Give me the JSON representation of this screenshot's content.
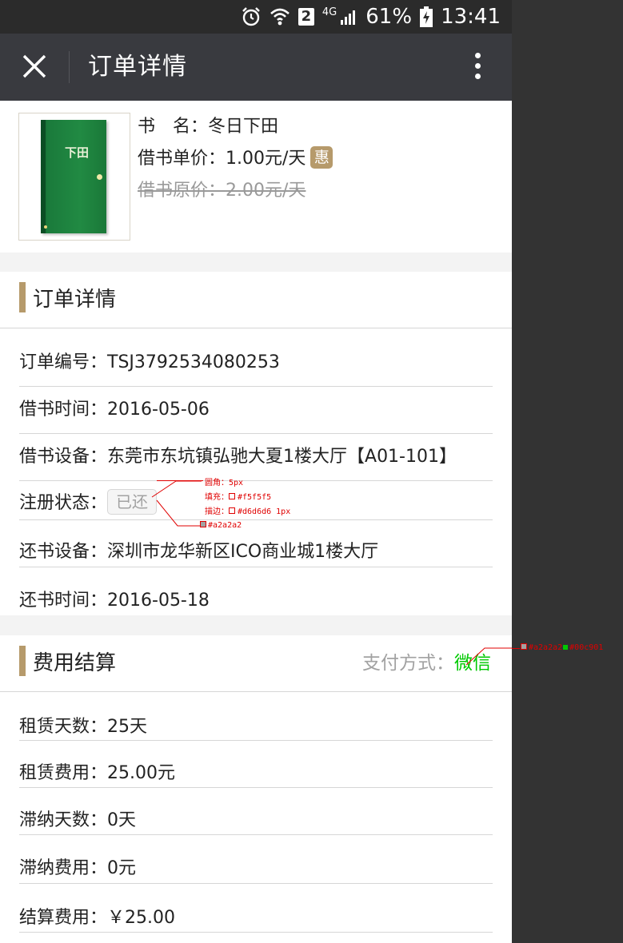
{
  "status_bar": {
    "signal_label": "2",
    "network": "4G",
    "battery": "61%",
    "time": "13:41"
  },
  "nav": {
    "title": "订单详情"
  },
  "book": {
    "cover_title": "下田",
    "name_label": "书　名：",
    "name_value": "冬日下田",
    "price_label": "借书单价：",
    "price_value": "1.00元/天",
    "discount_badge": "惠",
    "orig_label": "借书原价：",
    "orig_value": "2.00元/天"
  },
  "order": {
    "title": "订单详情",
    "rows": [
      {
        "label": "订单编号：",
        "value": "TSJ3792534080253"
      },
      {
        "label": "借书时间：",
        "value": "2016-05-06"
      },
      {
        "label": "借书设备：",
        "value": "东莞市东坑镇弘驰大夏1楼大厅【A01-101】"
      },
      {
        "label": "注册状态：",
        "value": "已还"
      },
      {
        "label": "还书设备：",
        "value": "深圳市龙华新区ICO商业城1楼大厅"
      },
      {
        "label": "还书时间：",
        "value": "2016-05-18"
      }
    ]
  },
  "fees": {
    "title": "费用结算",
    "pay_label": "支付方式：",
    "pay_value": "微信",
    "rows": [
      {
        "label": "租赁天数：",
        "value": "25天"
      },
      {
        "label": "租赁费用：",
        "value": "25.00元"
      },
      {
        "label": "滞纳天数：",
        "value": "0天"
      },
      {
        "label": "滞纳费用：",
        "value": "0元"
      },
      {
        "label": "结算费用：",
        "value": "￥25.00"
      }
    ]
  },
  "annotations": {
    "radius": "圆角：5px",
    "fill": "填充：",
    "fill_color": "#f5f5f5",
    "stroke": "描边：",
    "stroke_value": "#d6d6d6 1px",
    "text_color": "#a2a2a2",
    "pay_label_color": "#a2a2a2",
    "pay_value_color": "#00c901"
  },
  "colors": {
    "accent": "#b69a6b",
    "nav_bg": "#393a3f",
    "wechat_green": "#00c901",
    "muted": "#a2a2a2"
  }
}
